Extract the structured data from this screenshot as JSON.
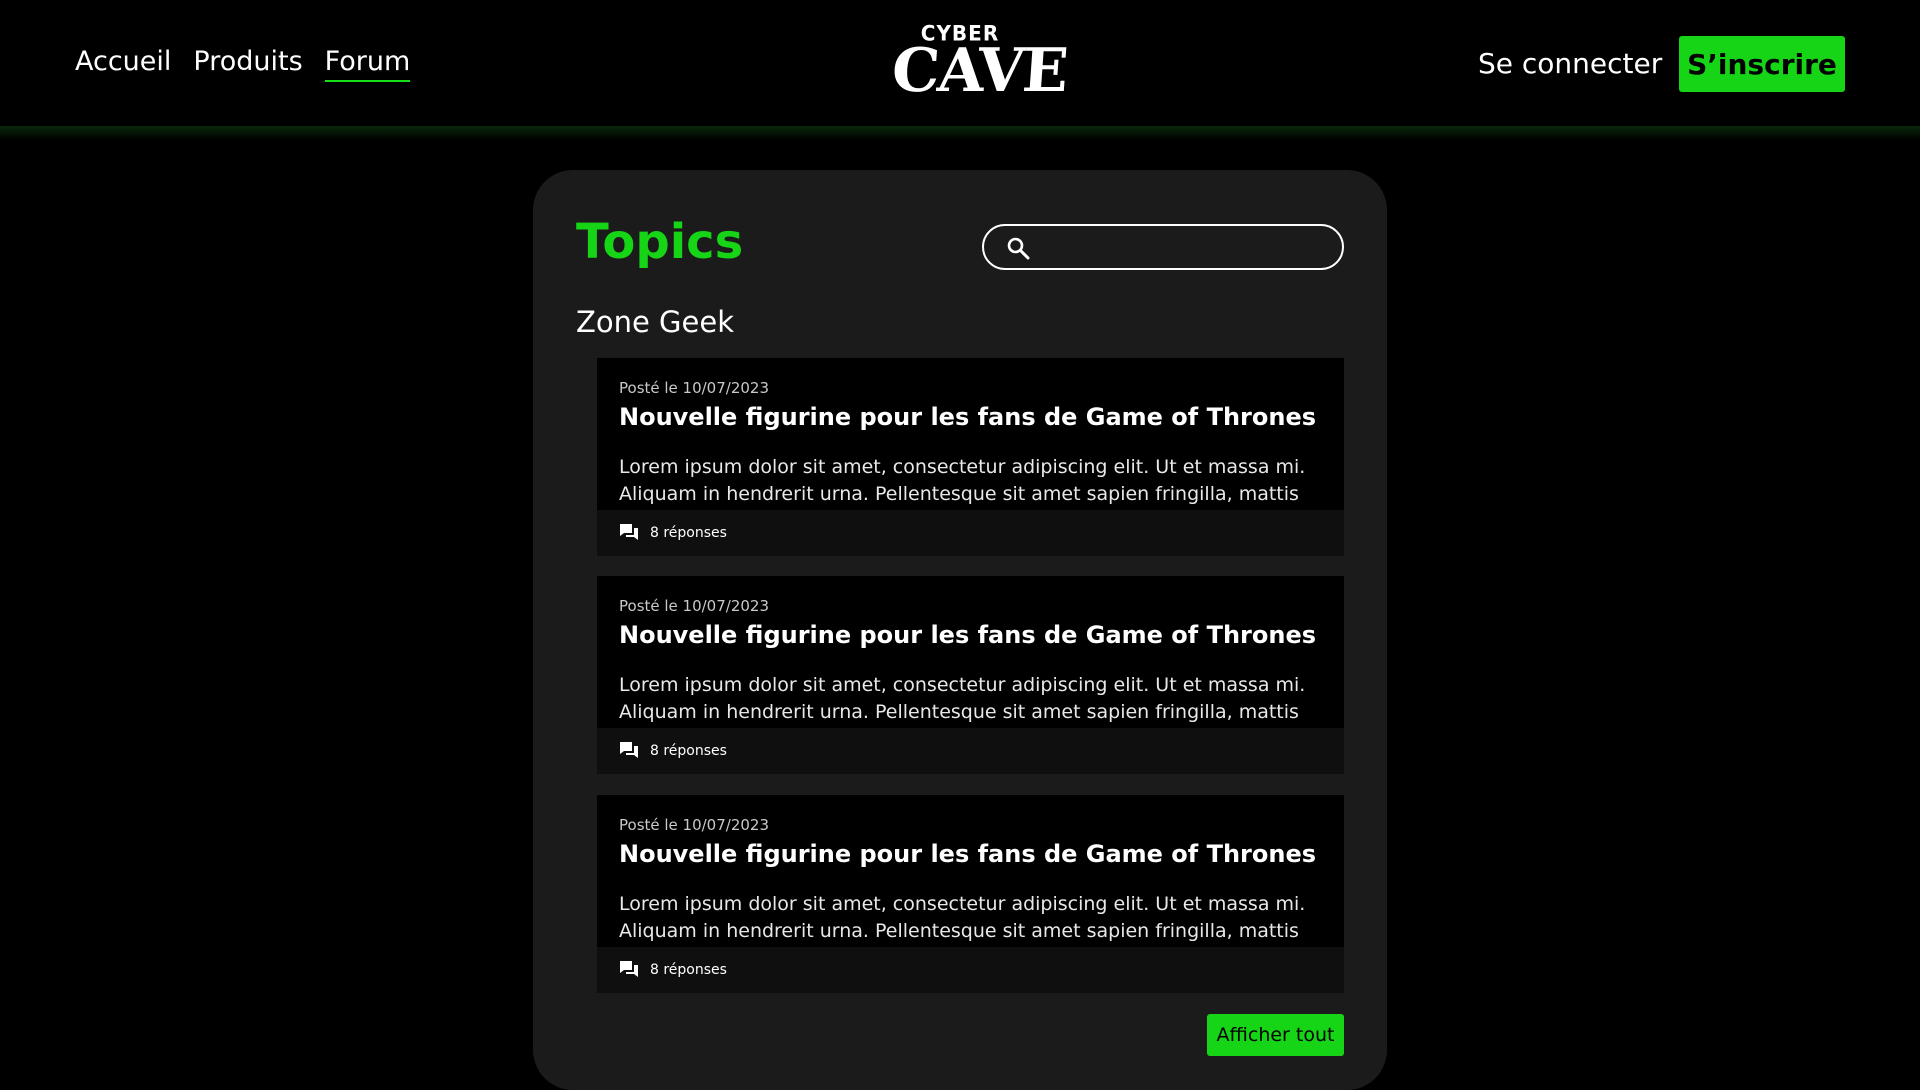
{
  "colors": {
    "accent": "#16d416",
    "background": "#000000",
    "panel": "#1b1b1b"
  },
  "nav": {
    "items": [
      {
        "label": "Accueil",
        "active": false
      },
      {
        "label": "Produits",
        "active": false
      },
      {
        "label": "Forum",
        "active": true
      }
    ]
  },
  "logo": {
    "top": "CYBER",
    "main": "CAVE"
  },
  "auth": {
    "login_label": "Se connecter",
    "signup_label": "S’inscrire"
  },
  "forum": {
    "title": "Topics",
    "search": {
      "placeholder": "",
      "value": "",
      "icon": "search-icon"
    },
    "section_title": "Zone Geek",
    "topics": [
      {
        "date": "Posté le 10/07/2023",
        "title": "Nouvelle figurine pour les fans de Game of Thrones",
        "excerpt": "Lorem ipsum dolor sit amet, consectetur adipiscing elit. Ut et massa mi. Aliquam in hendrerit urna. Pellentesque sit amet sapien fringilla, mattis ligula",
        "replies": "8 réponses",
        "icon": "comments-icon"
      },
      {
        "date": "Posté le 10/07/2023",
        "title": "Nouvelle figurine pour les fans de Game of Thrones",
        "excerpt": "Lorem ipsum dolor sit amet, consectetur adipiscing elit. Ut et massa mi. Aliquam in hendrerit urna. Pellentesque sit amet sapien fringilla, mattis ligula",
        "replies": "8 réponses",
        "icon": "comments-icon"
      },
      {
        "date": "Posté le 10/07/2023",
        "title": "Nouvelle figurine pour les fans de Game of Thrones",
        "excerpt": "Lorem ipsum dolor sit amet, consectetur adipiscing elit. Ut et massa mi. Aliquam in hendrerit urna. Pellentesque sit amet sapien fringilla, mattis ligula",
        "replies": "8 réponses",
        "icon": "comments-icon"
      }
    ],
    "show_all_label": "Afficher tout"
  }
}
